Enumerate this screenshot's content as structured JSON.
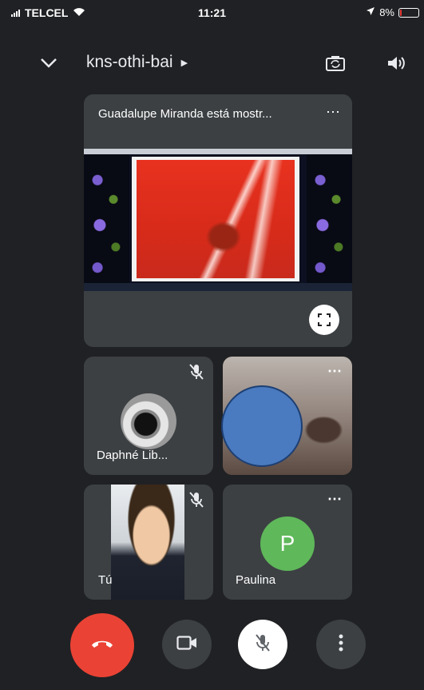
{
  "status_bar": {
    "carrier": "TELCEL",
    "time": "11:21",
    "battery": "8%",
    "battery_level": 0.08,
    "icons": [
      "signal-icon",
      "wifi-icon",
      "location-icon",
      "battery-icon"
    ]
  },
  "header": {
    "meeting_title": "kns-othi-bai",
    "icons": [
      "chevron-down-icon",
      "caret-right-icon",
      "switch-camera-icon",
      "speaker-icon"
    ]
  },
  "presentation": {
    "title": "Guadalupe Miranda está mostr...",
    "icons": [
      "more-options-icon",
      "fullscreen-icon"
    ]
  },
  "participants": [
    {
      "name": "Daphné Lib...",
      "mic_muted": true,
      "avatar": "photo"
    },
    {
      "name": "",
      "mic_muted": false,
      "avatar": "video"
    },
    {
      "name": "Tú",
      "mic_muted": true,
      "avatar": "video"
    },
    {
      "name": "Paulina",
      "mic_muted": false,
      "avatar_letter": "P",
      "avatar_color": "#5fb85a"
    }
  ],
  "controls": {
    "icons": [
      "end-call-icon",
      "camera-icon",
      "mic-off-icon",
      "more-vert-icon"
    ],
    "end_call_color": "#ea4335"
  }
}
